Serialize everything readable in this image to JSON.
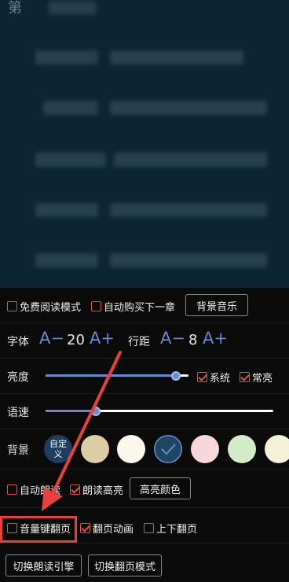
{
  "reader": {
    "chapter_char": "第"
  },
  "settings": {
    "row1": {
      "free_read_mode": "免费阅读模式",
      "auto_buy_next": "自动购买下一章",
      "bg_music": "背景音乐"
    },
    "font": {
      "label": "字体",
      "decrease": "A−",
      "size": "20",
      "increase": "A+",
      "line_spacing_label": "行距",
      "ls_decrease": "A−",
      "ls_value": "8",
      "ls_increase": "A+"
    },
    "brightness": {
      "label": "亮度",
      "level_percent": 91,
      "system": "系统",
      "always_on": "常亮"
    },
    "speech_rate": {
      "label": "语速",
      "level_percent": 22
    },
    "background": {
      "label": "背景",
      "custom_label": "自定义",
      "swatches": [
        "#1f3d5f",
        "#dccda6",
        "#fbf7ea",
        "#1e4660",
        "#f5d7dc",
        "#d3ecc8",
        "#f4f1d8"
      ],
      "selected_index": 3
    },
    "read_aloud": {
      "auto_read": "自动朗读",
      "highlight": "朗读高亮",
      "highlight_color": "高亮颜色"
    },
    "page_turn": {
      "volume_key": "音量键翻页",
      "animation": "翻页动画",
      "vertical": "上下翻页"
    },
    "bottom": {
      "switch_tts_engine": "切换朗读引擎",
      "switch_page_mode": "切换翻页模式"
    }
  },
  "colors": {
    "accent": "#6a8bd0",
    "checkbox": "#e0533f",
    "annotation": "#e8403a",
    "reader_bg": "#0d2533"
  }
}
